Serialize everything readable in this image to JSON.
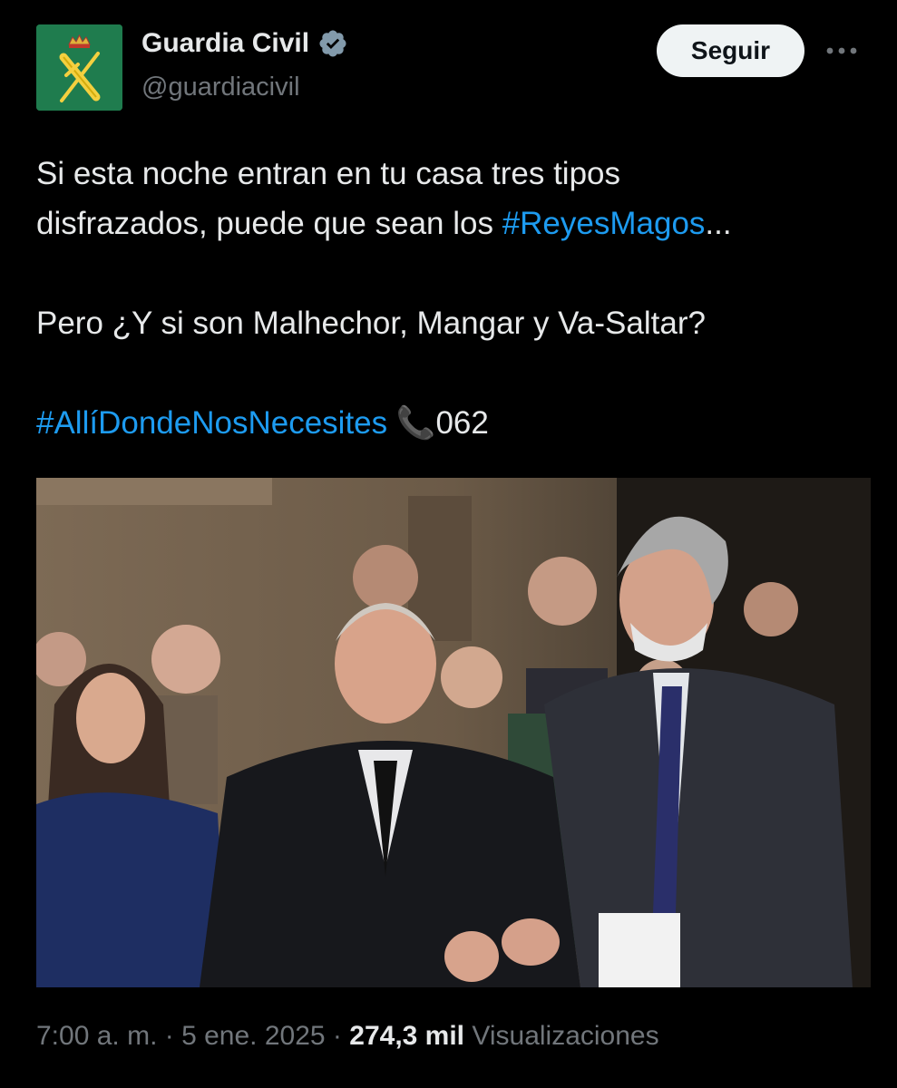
{
  "author": {
    "display_name": "Guardia Civil",
    "handle": "@guardiacivil",
    "verified": true,
    "avatar_icon": "guardia-civil-emblem-icon",
    "avatar_bg": "#1f7c4e"
  },
  "actions": {
    "follow_label": "Seguir",
    "more_icon": "more-options-icon"
  },
  "tweet": {
    "line1": "Si esta noche entran en tu casa tres tipos",
    "line2_text": "disfrazados, puede que sean los ",
    "line2_hashtag": "#ReyesMagos",
    "line2_tail": "...",
    "line3": "Pero ¿Y si son Malhechor, Mangar y Va-Saltar?",
    "line4_hashtag": "#AllíDondeNosNecesites",
    "line4_emoji": "📞",
    "line4_tail": "062"
  },
  "media": {
    "type": "photo"
  },
  "meta": {
    "time": "7:00 a. m.",
    "sep": "·",
    "date": "5 ene. 2025",
    "views_count": "274,3 mil",
    "views_label": "Visualizaciones"
  },
  "colors": {
    "background": "#000000",
    "text": "#e7e9ea",
    "secondary": "#71767b",
    "link": "#1d9bf0",
    "verified": "#829aab"
  }
}
